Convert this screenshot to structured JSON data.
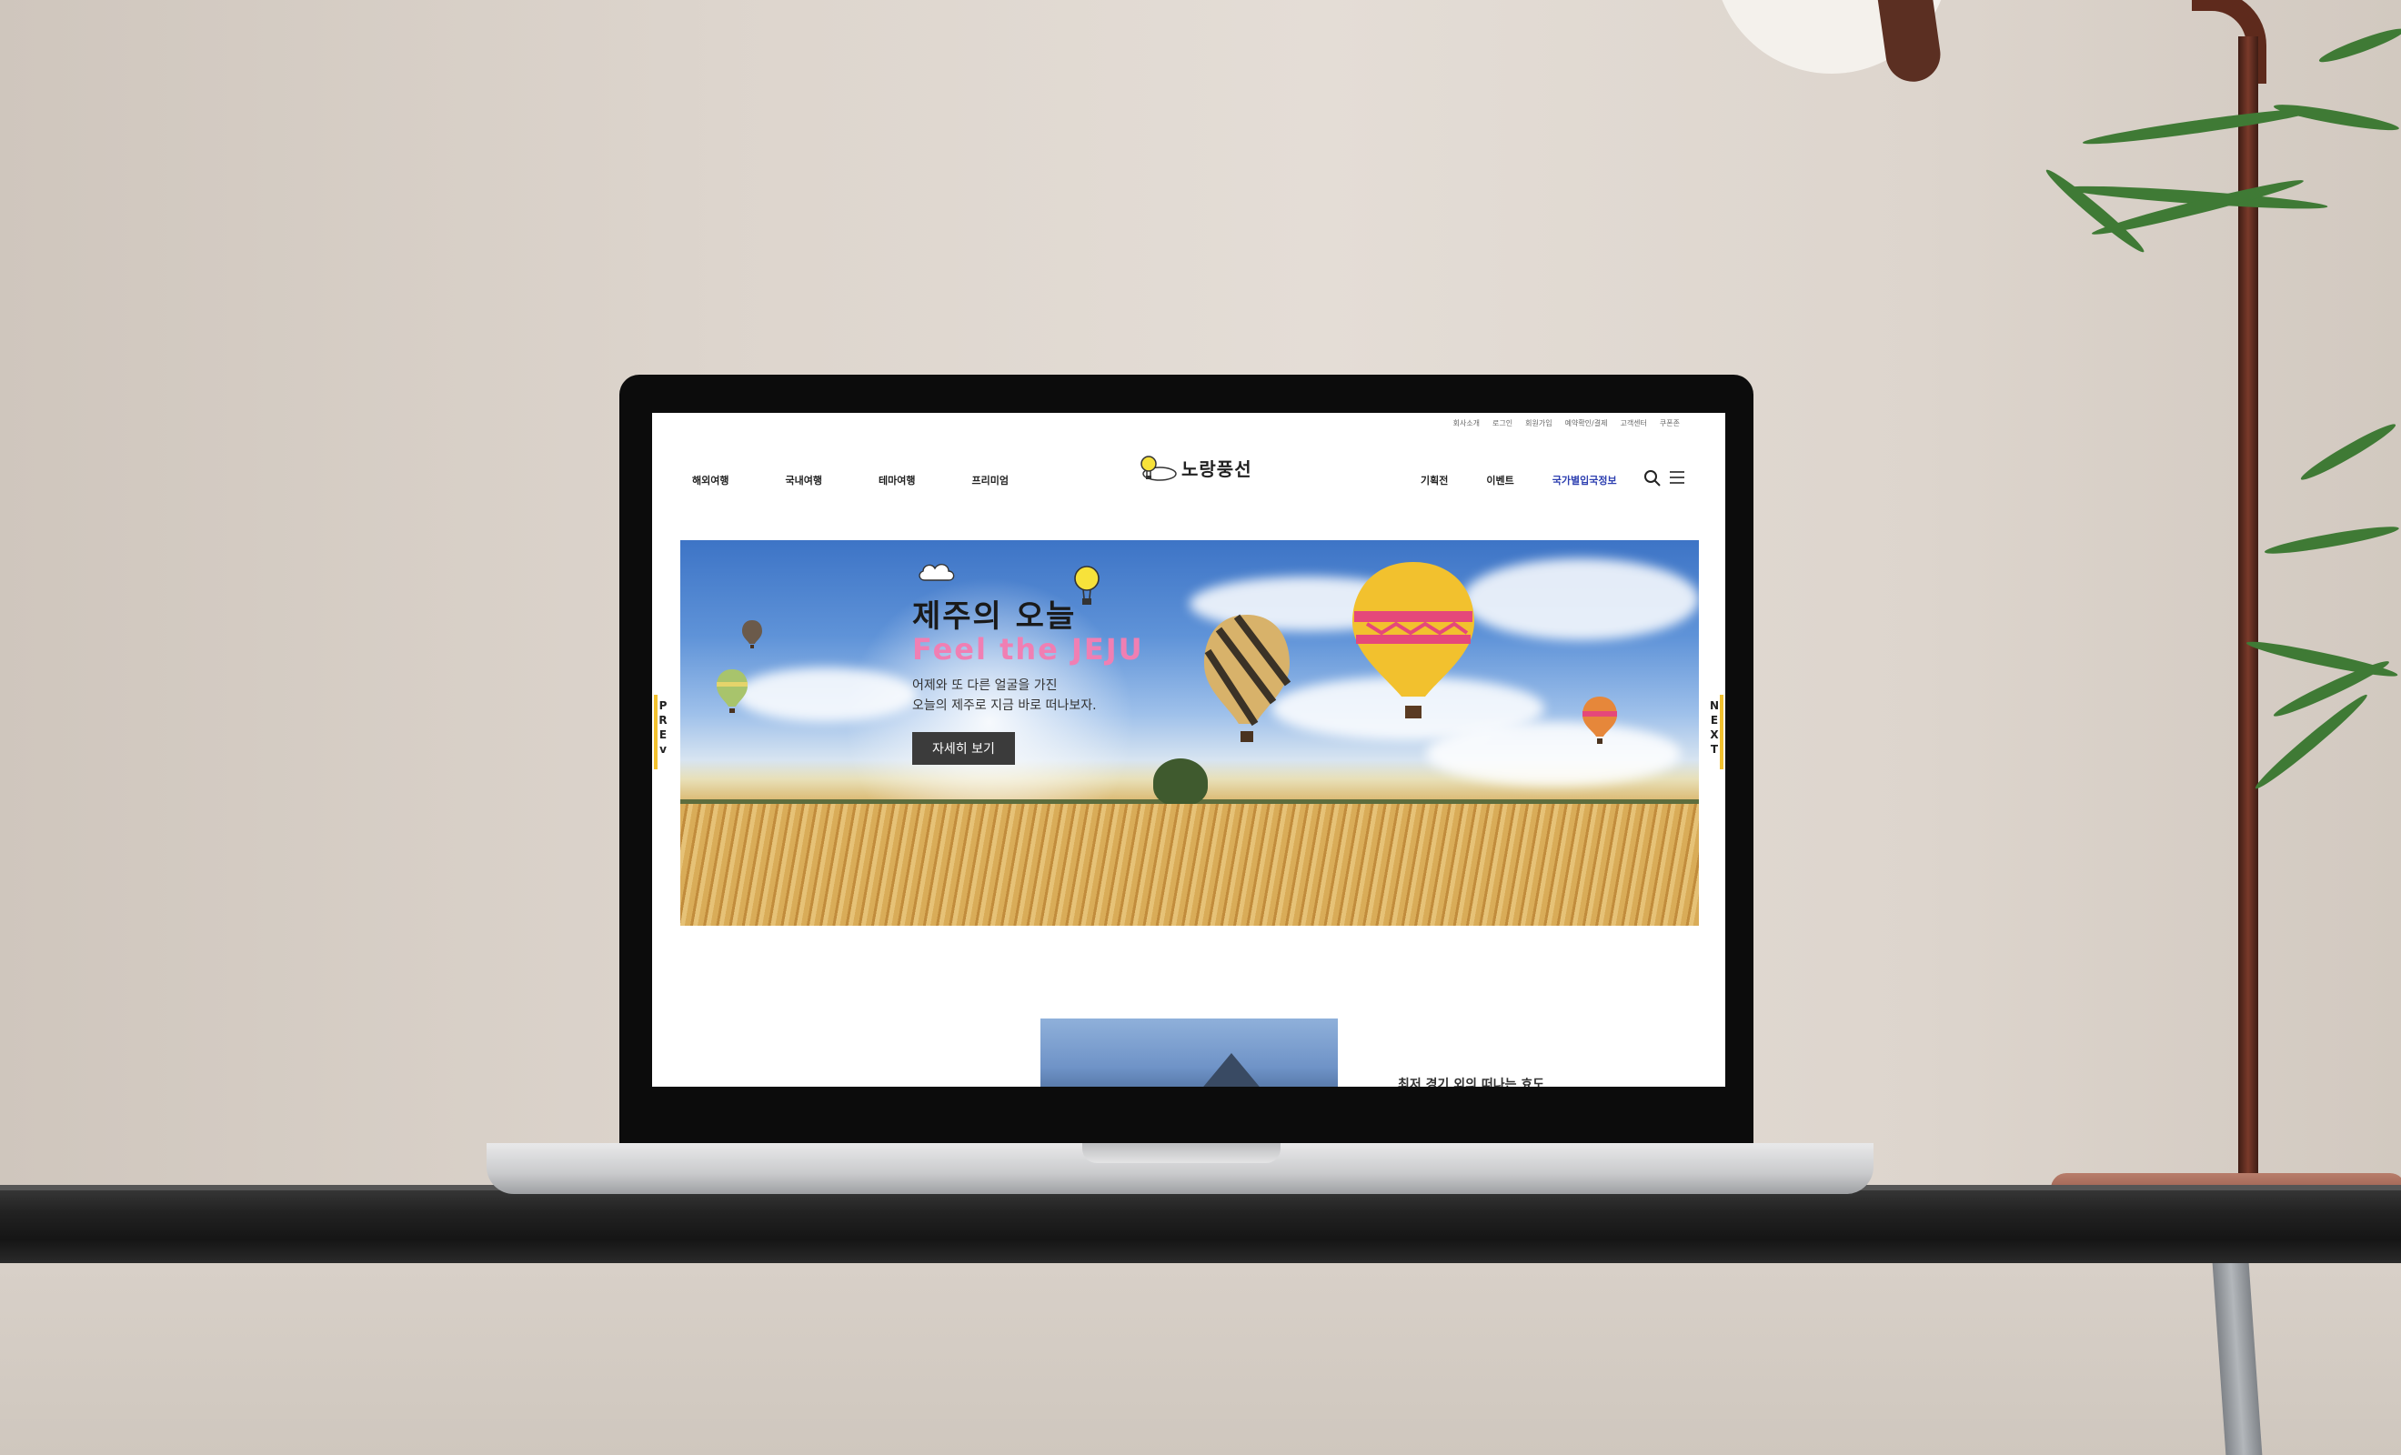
{
  "utility_nav": [
    "회사소개",
    "로그인",
    "회원가입",
    "예약확인/결제",
    "고객센터",
    "쿠폰존"
  ],
  "gnb_left": [
    "해외여행",
    "국내여행",
    "테마여행",
    "프리미엄"
  ],
  "gnb_right": [
    "기획전",
    "이벤트",
    "국가별입국정보"
  ],
  "logo": {
    "text": "노랑풍선"
  },
  "hero": {
    "title": "제주의 오늘",
    "subtitle": "Feel the JEJU",
    "desc_line1": "어제와 또 다른 얼굴을 가진",
    "desc_line2": "오늘의 제주로 지금 바로 떠나보자.",
    "button": "자세히 보기",
    "prev": [
      "P",
      "R",
      "E",
      "v"
    ],
    "next": [
      "N",
      "E",
      "X",
      "T"
    ]
  },
  "next_section": {
    "cut_title": "최저 경기 외의 떠나는 효도"
  },
  "icons": [
    "search-icon",
    "menu-icon",
    "balloon-logo-icon",
    "cloud-icon"
  ],
  "colors": {
    "accent_yellow": "#f2c12e",
    "pink": "#f07fb3",
    "highlight_blue": "#2d3fb0"
  }
}
